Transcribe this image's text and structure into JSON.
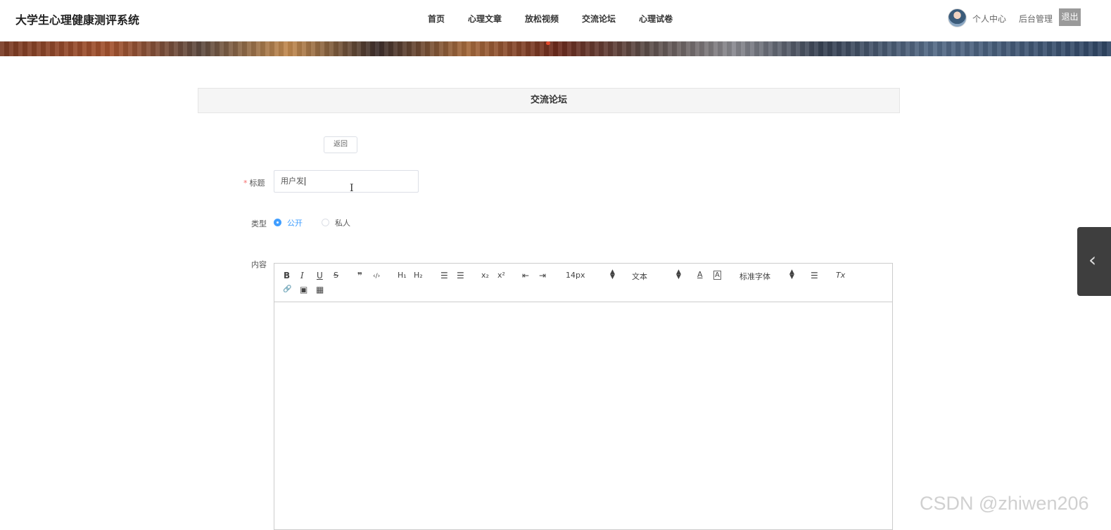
{
  "header": {
    "site_title": "大学生心理健康测评系统",
    "nav": [
      "首页",
      "心理文章",
      "放松视频",
      "交流论坛",
      "心理试卷"
    ],
    "personal_center": "个人中心",
    "admin": "后台管理",
    "logout": "退出"
  },
  "section": {
    "title": "交流论坛"
  },
  "form": {
    "back": "返回",
    "title_label": "标题",
    "title_value": "用户发",
    "type_label": "类型",
    "type_options": [
      "公开",
      "私人"
    ],
    "type_selected": "公开",
    "content_label": "内容"
  },
  "editor": {
    "font_size": "14px",
    "header_select": "文本",
    "font_family": "标准字体",
    "buttons": {
      "bold": "B",
      "italic": "I",
      "underline": "U",
      "strike": "S",
      "blockquote": "❞",
      "code": "‹/›",
      "h1": "H₁",
      "h2": "H₂",
      "ordered": "☰",
      "bullet": "☰",
      "sub": "x₂",
      "sup": "x²",
      "outdent": "⇤",
      "indent": "⇥",
      "color": "A",
      "background": "A",
      "align": "☰",
      "clean": "Tx",
      "link": "🔗",
      "image": "▣",
      "video": "▦"
    }
  },
  "watermark": "CSDN @zhiwen206",
  "colors": {
    "accent": "#409eff",
    "required": "#f56c6c",
    "logout_bg": "#9a9a9a"
  }
}
